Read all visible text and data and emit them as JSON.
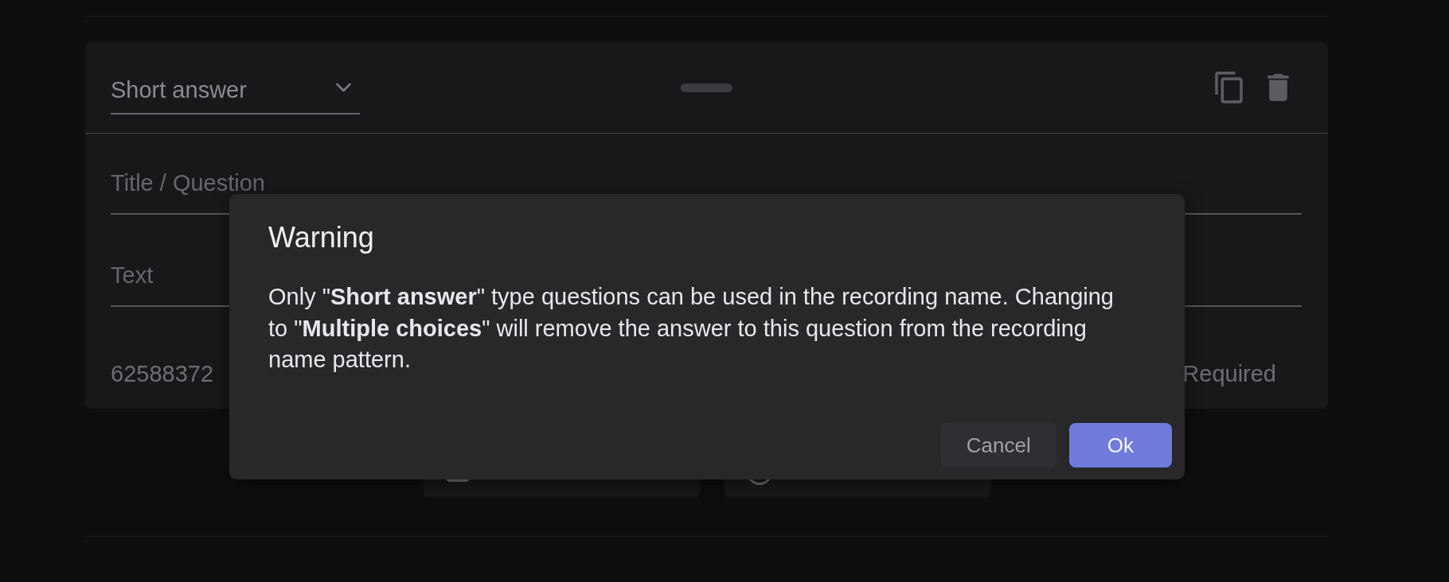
{
  "question_card": {
    "type_select": {
      "value": "Short answer"
    },
    "title_field": {
      "placeholder": "Title / Question"
    },
    "text_field": {
      "placeholder": "Text"
    },
    "number": "62588372",
    "required_label": "Required"
  },
  "answer_options": [
    {
      "kind": "checkbox"
    },
    {
      "kind": "radio"
    }
  ],
  "dialog": {
    "title": "Warning",
    "message": "Only \"**Short answer**\" type questions can be used in the recording name. Changing to \"**Multiple choices**\" will remove the answer to this question from the recording name pattern.",
    "buttons": [
      {
        "label": "Cancel",
        "kind": "secondary"
      },
      {
        "label": "Ok",
        "kind": "primary"
      }
    ]
  }
}
